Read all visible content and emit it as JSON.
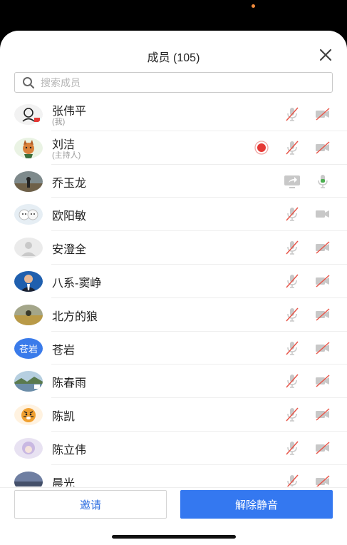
{
  "header": {
    "title": "成员 (105)",
    "close_icon": "close-icon"
  },
  "search": {
    "placeholder": "搜索成员",
    "value": ""
  },
  "colors": {
    "accent": "#3478f0",
    "muted_icon": "#c8c8c8",
    "mute_slash": "#e8564a",
    "record": "#e53935",
    "active_mic": "#4caf50"
  },
  "members": [
    {
      "name": "张伟平",
      "role": "(我)",
      "avatar": "person-sketch",
      "mic": "muted",
      "cam": "off"
    },
    {
      "name": "刘洁",
      "role": "(主持人)",
      "avatar": "cartoon-fox",
      "recording": true,
      "mic": "muted",
      "cam": "off"
    },
    {
      "name": "乔玉龙",
      "role": "",
      "avatar": "landscape-person",
      "share": true,
      "mic": "active"
    },
    {
      "name": "欧阳敏",
      "role": "",
      "avatar": "cartoon-pets",
      "mic": "muted",
      "cam": "on"
    },
    {
      "name": "安澄全",
      "role": "",
      "avatar": "default-person",
      "mic": "muted",
      "cam": "off"
    },
    {
      "name": "八系-窦峥",
      "role": "",
      "avatar": "man-in-suit",
      "mic": "muted",
      "cam": "off"
    },
    {
      "name": "北方的狼",
      "role": "",
      "avatar": "landscape-field",
      "mic": "muted",
      "cam": "off"
    },
    {
      "name": "苍岩",
      "role": "",
      "avatar_text": "苍岩",
      "avatar": "text-avatar",
      "mic": "muted",
      "cam": "off"
    },
    {
      "name": "陈春雨",
      "role": "",
      "avatar": "landscape-lake",
      "mic": "muted",
      "cam": "off"
    },
    {
      "name": "陈凯",
      "role": "",
      "avatar": "cartoon-tiger",
      "mic": "muted",
      "cam": "off"
    },
    {
      "name": "陈立伟",
      "role": "",
      "avatar": "anime-girl",
      "mic": "muted",
      "cam": "off"
    },
    {
      "name": "晨光",
      "role": "",
      "avatar": "sky-photo",
      "mic": "muted",
      "cam": "off"
    }
  ],
  "footer": {
    "invite_label": "邀请",
    "unmute_all_label": "解除静音"
  }
}
